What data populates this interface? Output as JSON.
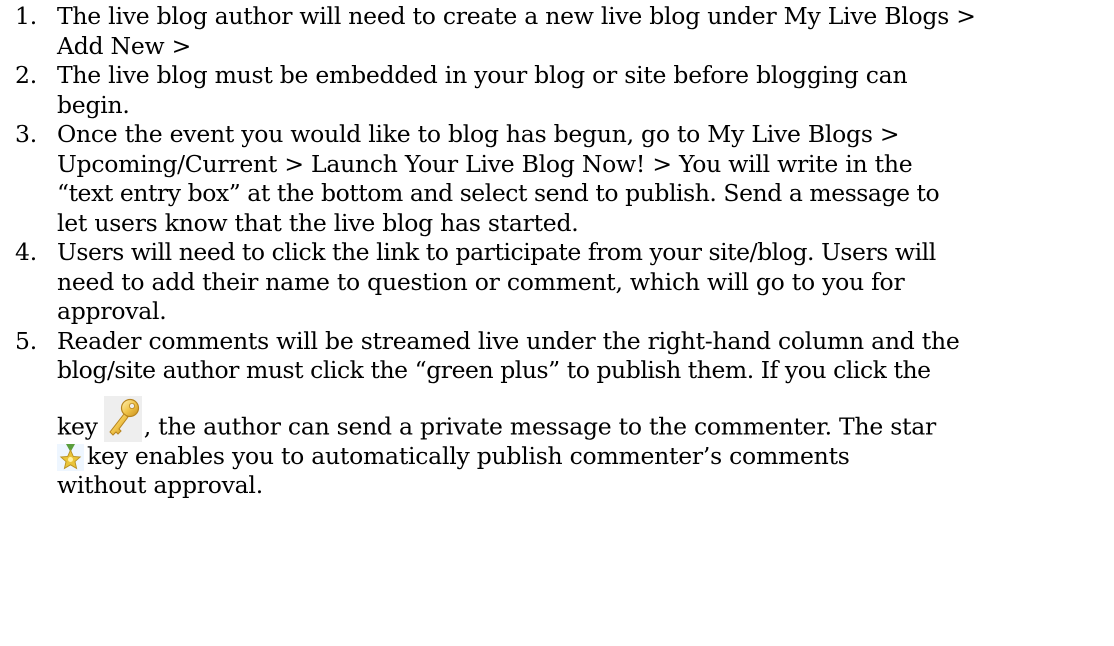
{
  "steps": [
    {
      "number": "1.",
      "lines": [
        "The live blog author will need to create a new live blog under My Live Blogs >",
        "Add New >"
      ]
    },
    {
      "number": "2.",
      "lines": [
        "The live blog must be embedded in your blog or site before blogging can",
        "begin."
      ]
    },
    {
      "number": "3.",
      "lines": [
        "Once the event you would like to blog has begun, go to My Live Blogs >",
        "Upcoming/Current > Launch Your Live Blog Now! > You will write in the",
        "“text entry box” at the bottom and select send to publish. Send a message to",
        "let users know that the live blog has started."
      ]
    },
    {
      "number": "4.",
      "lines": [
        "Users will need to click the link to participate from your site/blog. Users will",
        "need to add their name to question or comment, which will go to you for",
        "approval."
      ]
    },
    {
      "number": "5.",
      "lines": [
        "Reader comments will be streamed live under the right-hand column and the",
        "blog/site author must click the “green plus” to publish them. If you click the"
      ],
      "key_line": {
        "before": "key",
        "after": ", the author can send a private message to the commenter. The star"
      },
      "star_line": {
        "after": "key enables you to automatically publish commenter’s comments"
      },
      "last_line": "without approval."
    }
  ],
  "icons": {
    "key": "key-icon",
    "star": "star-badge-icon",
    "key_color": "#e8b83a",
    "star_color": "#e9c43a",
    "star_ribbon_color": "#5a9e3c"
  }
}
